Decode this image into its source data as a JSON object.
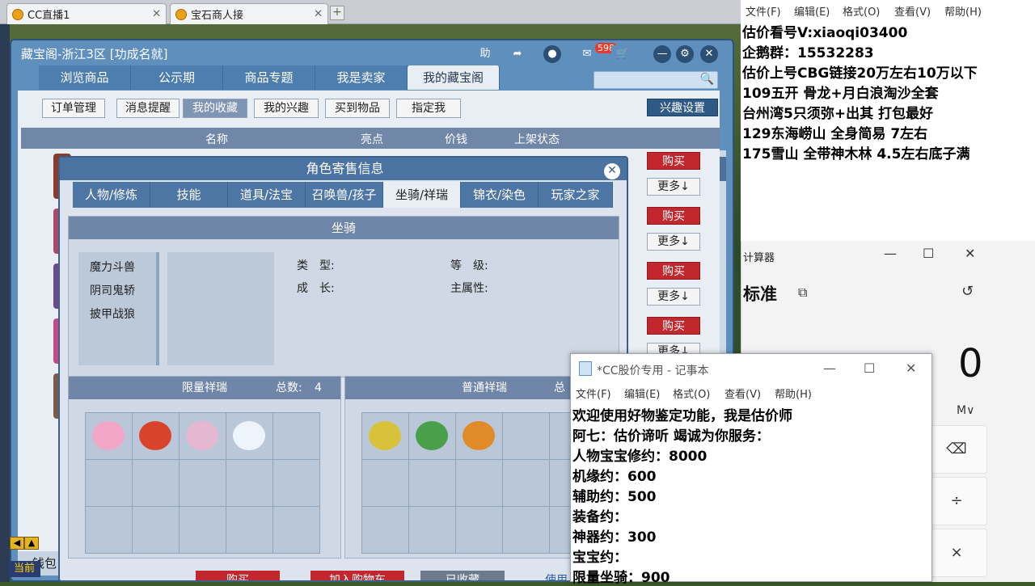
{
  "browser_tabs": [
    {
      "label": "CC直播1",
      "close": "✕"
    },
    {
      "label": "宝石商人接",
      "close": "✕"
    }
  ],
  "new_tab": "+",
  "main_window": {
    "title": "藏宝阁-浙江3区 [功成名就]",
    "help": "助",
    "badge": "598",
    "nav": [
      "浏览商品",
      "公示期",
      "商品专题",
      "我是卖家",
      "我的藏宝阁"
    ],
    "active_nav": "我的藏宝阁",
    "subtabs": [
      "订单管理",
      "消息提醒",
      "我的收藏",
      "我的兴趣",
      "买到物品",
      "指定我"
    ],
    "active_subtab": "我的收藏",
    "interest_settings": "兴趣设置",
    "table_headers": [
      "名称",
      "亮点",
      "价钱",
      "上架状态"
    ],
    "buy_label": "购买",
    "more_label": "更多↓",
    "wallet": "钱包"
  },
  "dialog": {
    "title": "角色寄售信息",
    "close": "✕",
    "tabs": [
      "人物/修炼",
      "技能",
      "道具/法宝",
      "召唤兽/孩子",
      "坐骑/祥瑞",
      "锦衣/染色",
      "玩家之家"
    ],
    "active_tab": "坐骑/祥瑞",
    "mount_header": "坐骑",
    "mounts": [
      "魔力斗兽",
      "阴司鬼轿",
      "披甲战狼"
    ],
    "fields": {
      "type": "类　型:",
      "level": "等　级:",
      "growth": "成　长:",
      "main_attr": "主属性:"
    },
    "limited": {
      "title": "限量祥瑞",
      "total_label": "总数:",
      "total": "4"
    },
    "normal": {
      "title": "普通祥瑞",
      "total_label": "总"
    },
    "bottom_buttons": [
      "购买",
      "加入购物车",
      "已收藏"
    ],
    "bottom_link": "使用"
  },
  "notepad_top": {
    "menu": [
      "文件(F)",
      "编辑(E)",
      "格式(O)",
      "查看(V)",
      "帮助(H)"
    ],
    "lines": [
      "估价看号V:xiaoqi03400",
      "企鹅群：15532283",
      "估价上号CBG链接20万左右10万以下",
      "109五开 骨龙+月白浪淘沙全套",
      "台州湾5只须弥+出其 打包最好",
      "129东海崂山 全身简易  7左右",
      "175雪山 全带神木林  4.5左右底子满"
    ]
  },
  "calculator": {
    "title": "计算器",
    "mode": "标准",
    "display": "0",
    "memory": "M∨",
    "keys": [
      "⌫",
      "÷",
      "×"
    ],
    "controls": [
      "—",
      "☐",
      "✕"
    ]
  },
  "notepad_bottom": {
    "title": "*CC股价专用 - 记事本",
    "controls": [
      "—",
      "☐",
      "✕"
    ],
    "menu": [
      "文件(F)",
      "编辑(E)",
      "格式(O)",
      "查看(V)",
      "帮助(H)"
    ],
    "lines": [
      "欢迎使用好物鉴定功能，我是估价师",
      "阿七：估价谛听 竭诚为你服务：",
      "人物宝宝修约：8000",
      "机缘约：600",
      "辅助约：500",
      "装备约：",
      "神器约：300",
      "宝宝约：",
      "限量坐骑：900"
    ]
  },
  "game_hud": {
    "current": "当前"
  },
  "colors": {
    "accent_blue": "#4a73a2",
    "buy_red": "#c2272d",
    "badge_red": "#e63a2e"
  }
}
